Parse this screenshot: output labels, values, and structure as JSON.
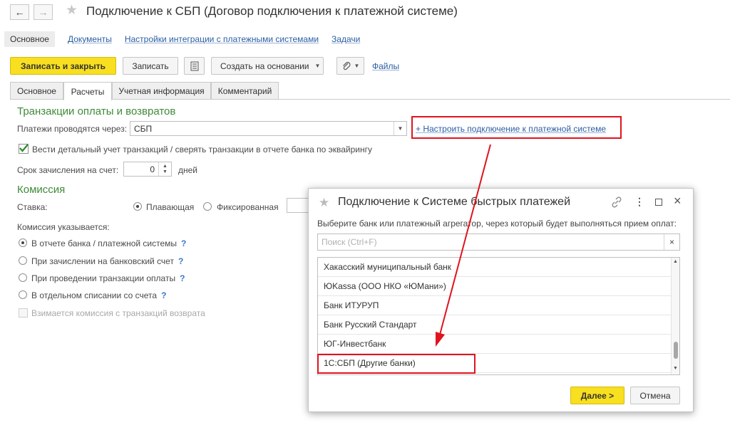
{
  "window": {
    "title": "Подключение к СБП (Договор подключения к платежной системе)",
    "back_icon": "←",
    "forward_icon": "→",
    "favorite_icon": "★"
  },
  "top_nav": {
    "items": [
      {
        "label": "Основное"
      },
      {
        "label": "Документы"
      },
      {
        "label": "Настройки интеграции с платежными системами"
      },
      {
        "label": "Задачи"
      }
    ]
  },
  "toolbar": {
    "save_close": "Записать и закрыть",
    "save": "Записать",
    "create_based": "Создать на основании",
    "files": "Файлы"
  },
  "tabs": [
    {
      "label": "Основное"
    },
    {
      "label": "Расчеты"
    },
    {
      "label": "Учетная информация"
    },
    {
      "label": "Комментарий"
    }
  ],
  "transactions": {
    "heading": "Транзакции оплаты и возвратов",
    "payments_label": "Платежи проводятся через:",
    "payments_value": "СБП",
    "setup_link": "+ Настроить подключение к платежной системе",
    "detail_checkbox_label": "Вести детальный учет транзакций / сверять транзакции в отчете банка по эквайрингу",
    "term_label": "Срок зачисления на счет:",
    "term_value": "0",
    "term_unit": "дней"
  },
  "commission": {
    "heading": "Комиссия",
    "rate_label": "Ставка:",
    "rate_floating": "Плавающая",
    "rate_fixed": "Фиксированная",
    "specified_label": "Комиссия указывается:",
    "options": [
      {
        "label": "В отчете банка / платежной системы",
        "help": "?"
      },
      {
        "label": "При зачислении на банковский счет",
        "help": "?"
      },
      {
        "label": "При проведении транзакции оплаты",
        "help": "?"
      },
      {
        "label": "В отдельном списании со счета",
        "help": "?"
      }
    ],
    "refund_checkbox_label": "Взимается комиссия с транзакций возврата"
  },
  "dialog": {
    "title": "Подключение к Системе быстрых платежей",
    "prompt": "Выберите банк или платежный агрегатор, через который будет выполняться прием оплат:",
    "search_placeholder": "Поиск (Ctrl+F)",
    "clear_icon": "×",
    "banks": [
      {
        "label": "Хакасский муниципальный банк"
      },
      {
        "label": "ЮKassa (ООО НКО «ЮМани»)"
      },
      {
        "label": "Банк ИТУРУП"
      },
      {
        "label": "Банк Русский Стандарт"
      },
      {
        "label": "ЮГ-Инвестбанк"
      },
      {
        "label": "1С:СБП (Другие банки)"
      }
    ],
    "next_button": "Далее >",
    "cancel_button": "Отмена"
  },
  "colors": {
    "accent_yellow": "#f8df1f",
    "section_green": "#3f8a3a",
    "link_blue": "#2a5ea3",
    "highlight_red": "#e0141e"
  }
}
